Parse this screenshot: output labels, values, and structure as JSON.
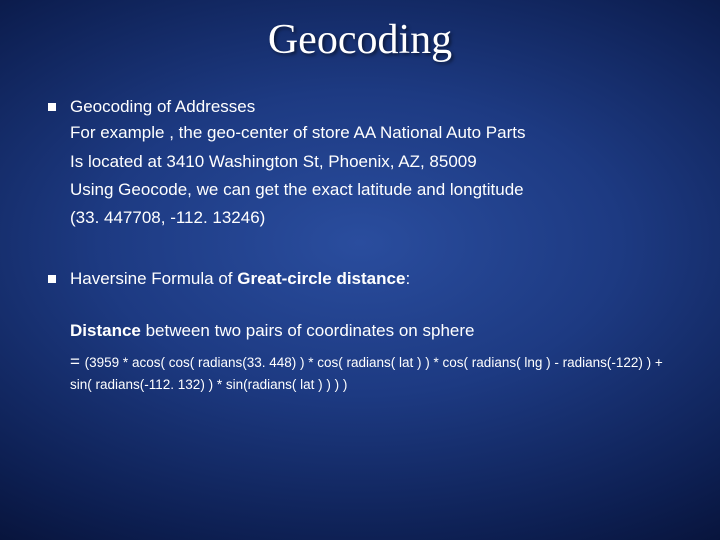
{
  "title": "Geocoding",
  "b1": {
    "head": "Geocoding of Addresses",
    "l1": "For example , the geo-center of store AA National Auto Parts",
    "l2": "Is located at 3410 Washington St, Phoenix, AZ, 85009",
    "l3": "Using Geocode, we can get the exact latitude and longtitude",
    "l4": "(33. 447708, -112. 13246)"
  },
  "b2": {
    "pre": "Haversine Formula of ",
    "bold": "Great-circle distance",
    "post": ":"
  },
  "dist": {
    "bold": "Distance",
    "rest": " between two pairs of coordinates on sphere"
  },
  "formula": {
    "eq": "= ",
    "body": "(3959 * acos( cos( radians(33. 448) ) * cos( radians( lat ) ) * cos( radians( lng ) - radians(-122) ) + sin( radians(-112. 132) ) * sin(radians( lat ) ) ) )"
  }
}
